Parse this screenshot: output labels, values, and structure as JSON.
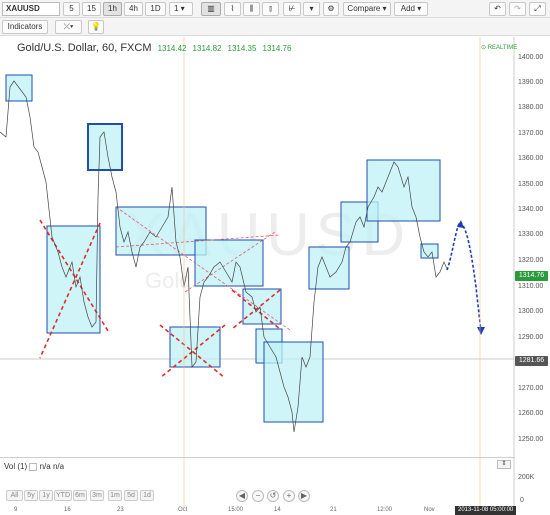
{
  "toolbar": {
    "symbol": "XAUUSD",
    "intervals": [
      "5",
      "15",
      "1h",
      "4h",
      "1D",
      "1"
    ],
    "active_interval": "1h",
    "compare_label": "Compare",
    "add_label": "Add",
    "indicators_label": "Indicators"
  },
  "chart": {
    "title": "Gold/U.S. Dollar, 60, FXCM",
    "open": "1314.42",
    "high": "1314.82",
    "low": "1314.35",
    "close": "1314.76",
    "watermark": "XAUUSD",
    "watermark_sub": "Gold",
    "realtime_label": "REALTIME",
    "price_ticks": [
      "1400.00",
      "1390.00",
      "1380.00",
      "1370.00",
      "1360.00",
      "1350.00",
      "1340.00",
      "1330.00",
      "1320.00",
      "1310.00",
      "1300.00",
      "1290.00",
      "1270.00",
      "1260.00",
      "1250.00"
    ],
    "last_price": "1314.76",
    "marker_price": "1281.66",
    "last_price_color": "#2a9b3a",
    "marker_color": "#555555",
    "date_tag": "2013-11-08 05:00:00"
  },
  "volume": {
    "label": "Vol (1)",
    "values": "n/a n/a",
    "tick": "200K",
    "zero": "0"
  },
  "ranges": [
    "All",
    "5y",
    "1y",
    "YTD",
    "6m",
    "3m",
    "1m",
    "5d",
    "1d"
  ],
  "xaxis": [
    "9",
    "16",
    "23",
    "Oct",
    "15:00",
    "14",
    "21",
    "12:00",
    "Nov"
  ]
}
